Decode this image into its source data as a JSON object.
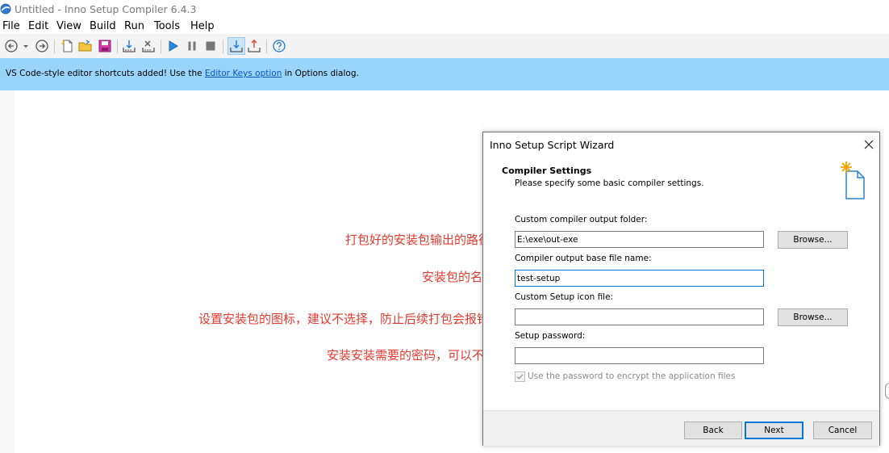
{
  "window": {
    "title": "Untitled - Inno Setup Compiler 6.4.3"
  },
  "menu": [
    "File",
    "Edit",
    "View",
    "Build",
    "Run",
    "Tools",
    "Help"
  ],
  "toolbar": {
    "icons": [
      "back-icon",
      "history-dropdown-icon",
      "forward-icon",
      "new-file-icon",
      "open-folder-icon",
      "save-icon",
      "compile-icon",
      "stop-compile-icon",
      "run-icon",
      "pause-icon",
      "terminate-icon",
      "target-setup-icon",
      "target-uninstall-icon",
      "help-icon"
    ],
    "active_icon": "target-setup-icon"
  },
  "banner": {
    "text_before": "VS Code-style editor shortcuts added! Use the ",
    "link_text": "Editor Keys option",
    "text_after": " in Options dialog.",
    "color": "#99d4fb"
  },
  "annotations": {
    "output_folder": "打包好的安装包输出的路径",
    "base_name": "安装包的名字",
    "icon_file": "设置安装包的图标，建议不选择，防止后续打包会报错",
    "password": "安装安装需要的密码，可以不写",
    "color": "#e53a2f"
  },
  "wizard": {
    "title": "Inno Setup Script Wizard",
    "heading": "Compiler Settings",
    "subheading": "Please specify some basic compiler settings.",
    "fields": {
      "output_folder_label": "Custom compiler output folder:",
      "output_folder_value": "E:\\exe\\out-exe",
      "base_name_label": "Compiler output base file name:",
      "base_name_value": "test-setup",
      "icon_label": "Custom Setup icon file:",
      "icon_value": "",
      "password_label": "Setup password:",
      "password_value": ""
    },
    "browse_label": "Browse...",
    "encrypt_label": "Use the password to encrypt the application files",
    "encrypt_checked": true,
    "encrypt_enabled": false,
    "buttons": {
      "back": "Back",
      "next": "Next",
      "cancel": "Cancel"
    }
  }
}
